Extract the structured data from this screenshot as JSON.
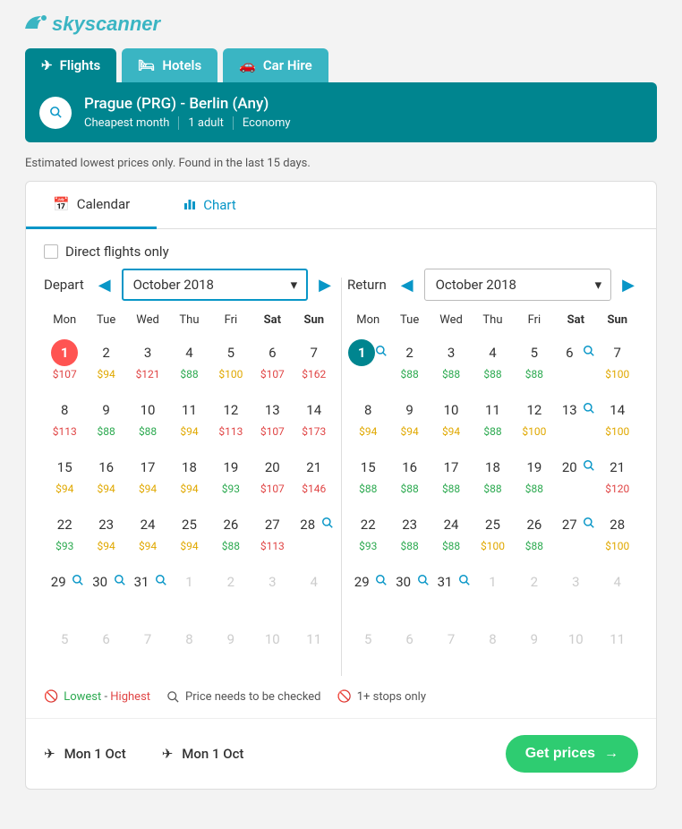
{
  "brand": "skyscanner",
  "nav": {
    "flights": "Flights",
    "hotels": "Hotels",
    "carhire": "Car Hire"
  },
  "search": {
    "route": "Prague (PRG) - Berlin (Any)",
    "month": "Cheapest month",
    "pax": "1 adult",
    "cabin": "Economy"
  },
  "note": "Estimated lowest prices only. Found in the last 15 days.",
  "views": {
    "calendar": "Calendar",
    "chart": "Chart"
  },
  "direct_label": "Direct flights only",
  "depart": {
    "label": "Depart",
    "month": "October 2018",
    "dow": [
      "Mon",
      "Tue",
      "Wed",
      "Thu",
      "Fri",
      "Sat",
      "Sun"
    ],
    "weeks": [
      [
        {
          "n": "1",
          "p": "$107",
          "c": "r",
          "sel": "red"
        },
        {
          "n": "2",
          "p": "$94",
          "c": "y"
        },
        {
          "n": "3",
          "p": "$121",
          "c": "r"
        },
        {
          "n": "4",
          "p": "$88",
          "c": "g"
        },
        {
          "n": "5",
          "p": "$100",
          "c": "y"
        },
        {
          "n": "6",
          "p": "$107",
          "c": "r"
        },
        {
          "n": "7",
          "p": "$162",
          "c": "r"
        }
      ],
      [
        {
          "n": "8",
          "p": "$113",
          "c": "r"
        },
        {
          "n": "9",
          "p": "$88",
          "c": "g"
        },
        {
          "n": "10",
          "p": "$88",
          "c": "g"
        },
        {
          "n": "11",
          "p": "$94",
          "c": "y"
        },
        {
          "n": "12",
          "p": "$113",
          "c": "r"
        },
        {
          "n": "13",
          "p": "$107",
          "c": "r"
        },
        {
          "n": "14",
          "p": "$173",
          "c": "r"
        }
      ],
      [
        {
          "n": "15",
          "p": "$94",
          "c": "y"
        },
        {
          "n": "16",
          "p": "$94",
          "c": "y"
        },
        {
          "n": "17",
          "p": "$94",
          "c": "y"
        },
        {
          "n": "18",
          "p": "$94",
          "c": "y"
        },
        {
          "n": "19",
          "p": "$93",
          "c": "g"
        },
        {
          "n": "20",
          "p": "$107",
          "c": "r"
        },
        {
          "n": "21",
          "p": "$146",
          "c": "r"
        }
      ],
      [
        {
          "n": "22",
          "p": "$93",
          "c": "g"
        },
        {
          "n": "23",
          "p": "$94",
          "c": "y"
        },
        {
          "n": "24",
          "p": "$94",
          "c": "y"
        },
        {
          "n": "25",
          "p": "$94",
          "c": "y"
        },
        {
          "n": "26",
          "p": "$88",
          "c": "g"
        },
        {
          "n": "27",
          "p": "$113",
          "c": "r"
        },
        {
          "n": "28",
          "srch": true
        }
      ],
      [
        {
          "n": "29",
          "srch": true
        },
        {
          "n": "30",
          "srch": true
        },
        {
          "n": "31",
          "srch": true
        },
        {
          "n": "1",
          "dim": true
        },
        {
          "n": "2",
          "dim": true
        },
        {
          "n": "3",
          "dim": true
        },
        {
          "n": "4",
          "dim": true
        }
      ],
      [
        {
          "n": "5",
          "dim": true
        },
        {
          "n": "6",
          "dim": true
        },
        {
          "n": "7",
          "dim": true
        },
        {
          "n": "8",
          "dim": true
        },
        {
          "n": "9",
          "dim": true
        },
        {
          "n": "10",
          "dim": true
        },
        {
          "n": "11",
          "dim": true
        }
      ]
    ]
  },
  "return": {
    "label": "Return",
    "month": "October 2018",
    "dow": [
      "Mon",
      "Tue",
      "Wed",
      "Thu",
      "Fri",
      "Sat",
      "Sun"
    ],
    "weeks": [
      [
        {
          "n": "1",
          "srch": true,
          "sel": "teal"
        },
        {
          "n": "2",
          "p": "$88",
          "c": "g"
        },
        {
          "n": "3",
          "p": "$88",
          "c": "g"
        },
        {
          "n": "4",
          "p": "$88",
          "c": "g"
        },
        {
          "n": "5",
          "p": "$88",
          "c": "g"
        },
        {
          "n": "6",
          "srch": true
        },
        {
          "n": "7",
          "p": "$100",
          "c": "y"
        }
      ],
      [
        {
          "n": "8",
          "p": "$94",
          "c": "y"
        },
        {
          "n": "9",
          "p": "$94",
          "c": "y"
        },
        {
          "n": "10",
          "p": "$94",
          "c": "y"
        },
        {
          "n": "11",
          "p": "$88",
          "c": "g"
        },
        {
          "n": "12",
          "p": "$100",
          "c": "y"
        },
        {
          "n": "13",
          "srch": true
        },
        {
          "n": "14",
          "p": "$100",
          "c": "y"
        }
      ],
      [
        {
          "n": "15",
          "p": "$88",
          "c": "g"
        },
        {
          "n": "16",
          "p": "$88",
          "c": "g"
        },
        {
          "n": "17",
          "p": "$88",
          "c": "g"
        },
        {
          "n": "18",
          "p": "$88",
          "c": "g"
        },
        {
          "n": "19",
          "p": "$88",
          "c": "g"
        },
        {
          "n": "20",
          "srch": true
        },
        {
          "n": "21",
          "p": "$120",
          "c": "r"
        }
      ],
      [
        {
          "n": "22",
          "p": "$93",
          "c": "g"
        },
        {
          "n": "23",
          "p": "$88",
          "c": "g"
        },
        {
          "n": "24",
          "p": "$88",
          "c": "g"
        },
        {
          "n": "25",
          "p": "$100",
          "c": "y"
        },
        {
          "n": "26",
          "p": "$88",
          "c": "g"
        },
        {
          "n": "27",
          "srch": true
        },
        {
          "n": "28",
          "p": "$100",
          "c": "y"
        }
      ],
      [
        {
          "n": "29",
          "srch": true
        },
        {
          "n": "30",
          "srch": true
        },
        {
          "n": "31",
          "srch": true
        },
        {
          "n": "1",
          "dim": true
        },
        {
          "n": "2",
          "dim": true
        },
        {
          "n": "3",
          "dim": true
        },
        {
          "n": "4",
          "dim": true
        }
      ],
      [
        {
          "n": "5",
          "dim": true
        },
        {
          "n": "6",
          "dim": true
        },
        {
          "n": "7",
          "dim": true
        },
        {
          "n": "8",
          "dim": true
        },
        {
          "n": "9",
          "dim": true
        },
        {
          "n": "10",
          "dim": true
        },
        {
          "n": "11",
          "dim": true
        }
      ]
    ]
  },
  "legend": {
    "lowest": "Lowest",
    "sep": " - ",
    "highest": "Highest",
    "check": "Price needs to be checked",
    "stops": "1+ stops only"
  },
  "footer": {
    "depart_date": "Mon 1 Oct",
    "return_date": "Mon 1 Oct",
    "cta": "Get prices"
  }
}
